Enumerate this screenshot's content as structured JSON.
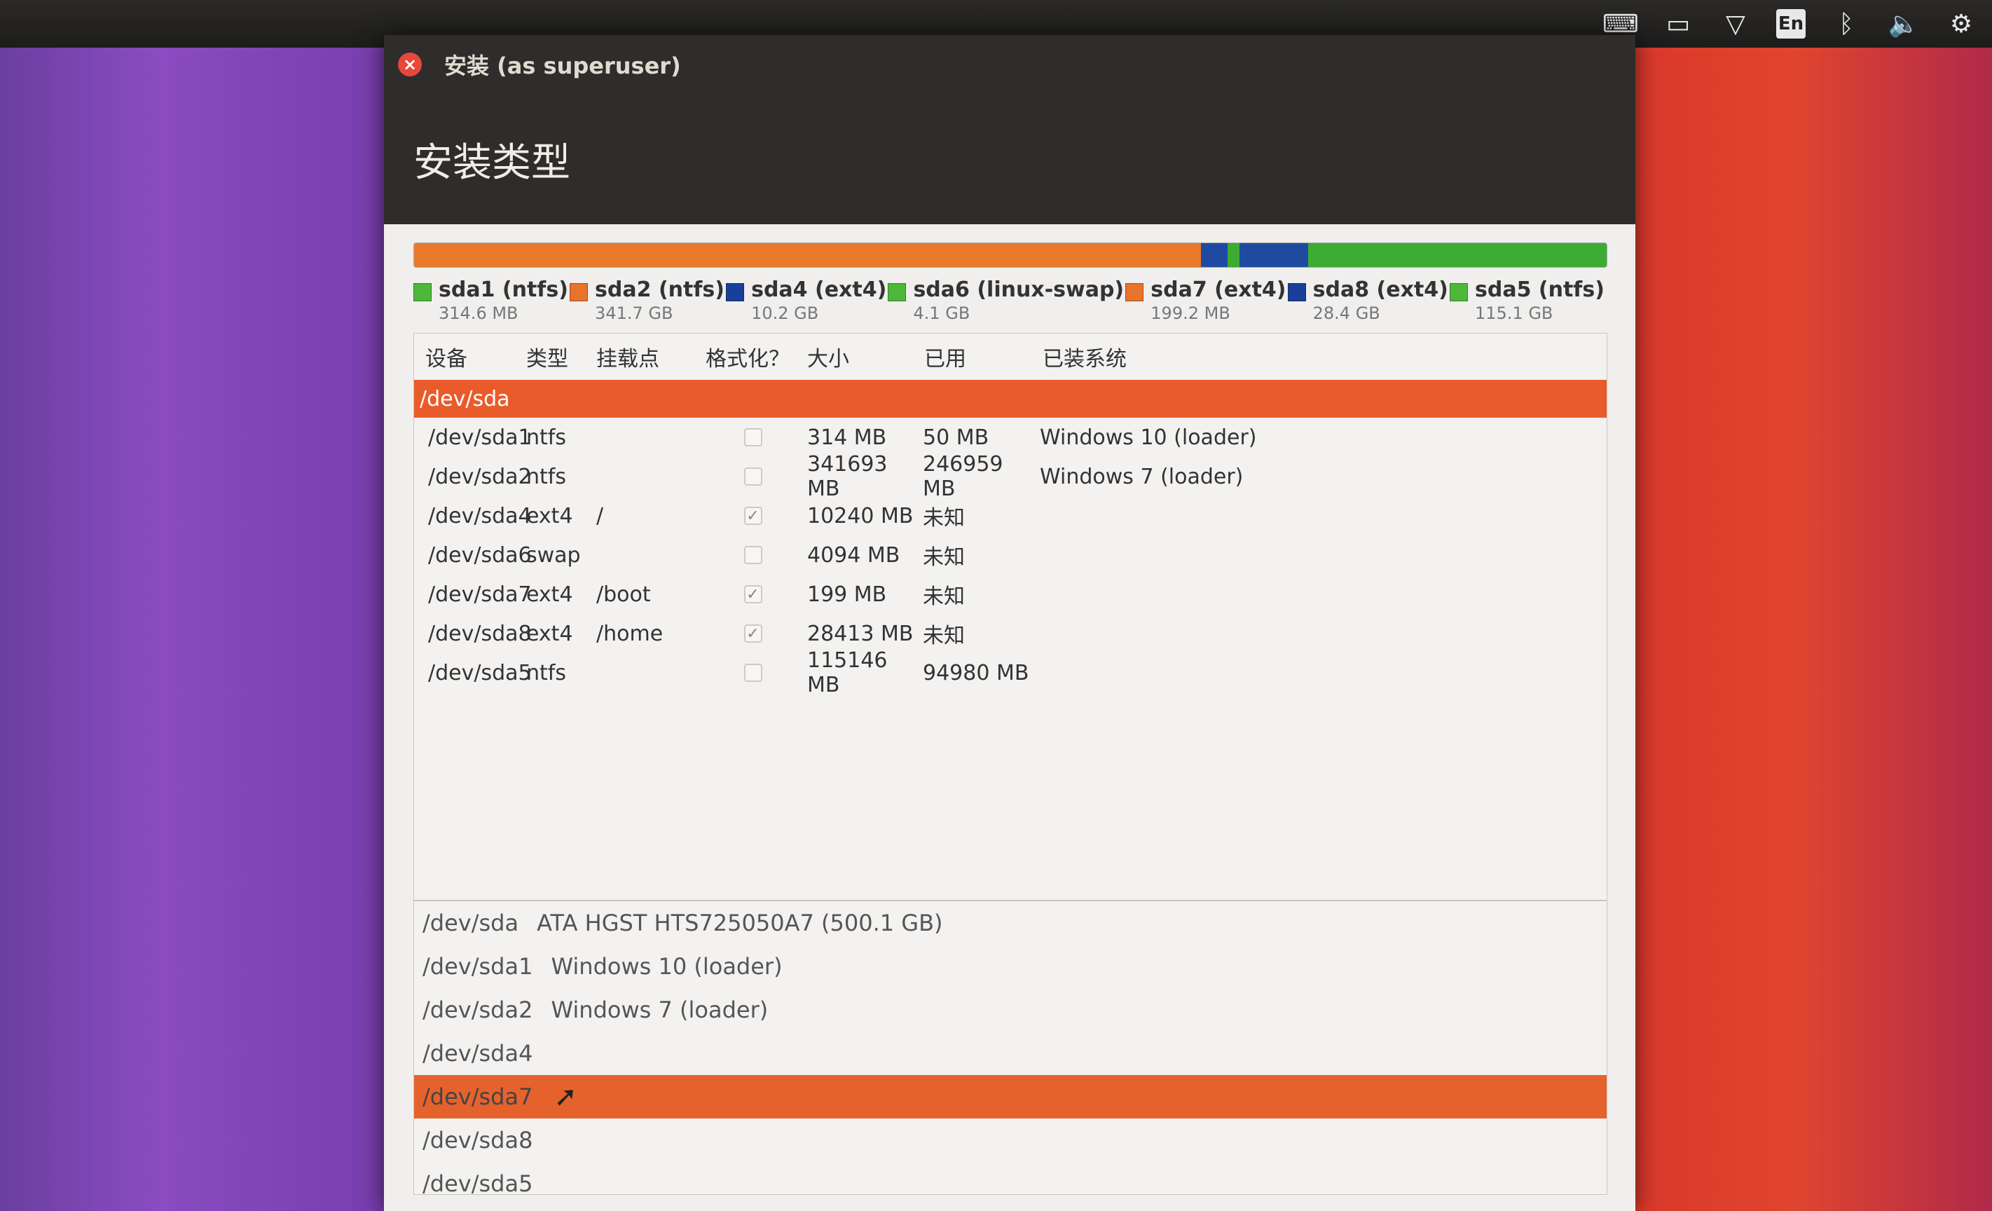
{
  "window": {
    "title": "安装 (as superuser)",
    "page_title": "安装类型"
  },
  "tray": {
    "keyboard": "keyboard-icon",
    "battery": "battery-icon",
    "wifi": "wifi-icon",
    "language": "En",
    "bluetooth": "bluetooth-icon",
    "volume": "volume-icon",
    "power": "power-icon"
  },
  "partition_bar": {
    "segments": [
      {
        "color": "#e87a2a",
        "fraction": 0.66
      },
      {
        "color": "#1f4aa0",
        "fraction": 0.022
      },
      {
        "color": "#3dac32",
        "fraction": 0.01
      },
      {
        "color": "#1f4aa0",
        "fraction": 0.058
      },
      {
        "color": "#3dac32",
        "fraction": 0.25
      }
    ]
  },
  "legend": [
    {
      "name": "sda1 (ntfs)",
      "size": "314.6 MB",
      "color": "#4db83a"
    },
    {
      "name": "sda2 (ntfs)",
      "size": "341.7 GB",
      "color": "#e8732a"
    },
    {
      "name": "sda4 (ext4)",
      "size": "10.2 GB",
      "color": "#1a3f9a"
    },
    {
      "name": "sda6 (linux-swap)",
      "size": "4.1 GB",
      "color": "#4db83a"
    },
    {
      "name": "sda7 (ext4)",
      "size": "199.2 MB",
      "color": "#e8732a"
    },
    {
      "name": "sda8 (ext4)",
      "size": "28.4 GB",
      "color": "#1a3f9a"
    },
    {
      "name": "sda5 (ntfs)",
      "size": "115.1 GB",
      "color": "#4db83a"
    }
  ],
  "table": {
    "headers": {
      "device": "设备",
      "type": "类型",
      "mount": "挂载点",
      "format": "格式化？",
      "size": "大小",
      "used": "已用",
      "system": "已装系统"
    },
    "disk": "/dev/sda",
    "rows": [
      {
        "device": "/dev/sda1",
        "type": "ntfs",
        "mount": "",
        "format": false,
        "size": "314 MB",
        "used": "50 MB",
        "system": "Windows 10 (loader)"
      },
      {
        "device": "/dev/sda2",
        "type": "ntfs",
        "mount": "",
        "format": false,
        "size": "341693 MB",
        "used": "246959 MB",
        "system": "Windows 7 (loader)"
      },
      {
        "device": "/dev/sda4",
        "type": "ext4",
        "mount": "/",
        "format": true,
        "size": "10240 MB",
        "used": "未知",
        "system": ""
      },
      {
        "device": "/dev/sda6",
        "type": "swap",
        "mount": "",
        "format": false,
        "size": "4094 MB",
        "used": "未知",
        "system": ""
      },
      {
        "device": "/dev/sda7",
        "type": "ext4",
        "mount": "/boot",
        "format": true,
        "size": "199 MB",
        "used": "未知",
        "system": ""
      },
      {
        "device": "/dev/sda8",
        "type": "ext4",
        "mount": "/home",
        "format": true,
        "size": "28413 MB",
        "used": "未知",
        "system": ""
      },
      {
        "device": "/dev/sda5",
        "type": "ntfs",
        "mount": "",
        "format": false,
        "size": "115146 MB",
        "used": "94980 MB",
        "system": ""
      }
    ]
  },
  "bootloader_list": [
    {
      "device": "/dev/sda",
      "desc": "ATA HGST HTS725050A7 (500.1 GB)",
      "selected": false
    },
    {
      "device": "/dev/sda1",
      "desc": "Windows 10 (loader)",
      "selected": false
    },
    {
      "device": "/dev/sda2",
      "desc": "Windows 7 (loader)",
      "selected": false
    },
    {
      "device": "/dev/sda4",
      "desc": "",
      "selected": false
    },
    {
      "device": "/dev/sda7",
      "desc": "",
      "selected": true
    },
    {
      "device": "/dev/sda8",
      "desc": "",
      "selected": false
    },
    {
      "device": "/dev/sda5",
      "desc": "",
      "selected": false
    }
  ]
}
